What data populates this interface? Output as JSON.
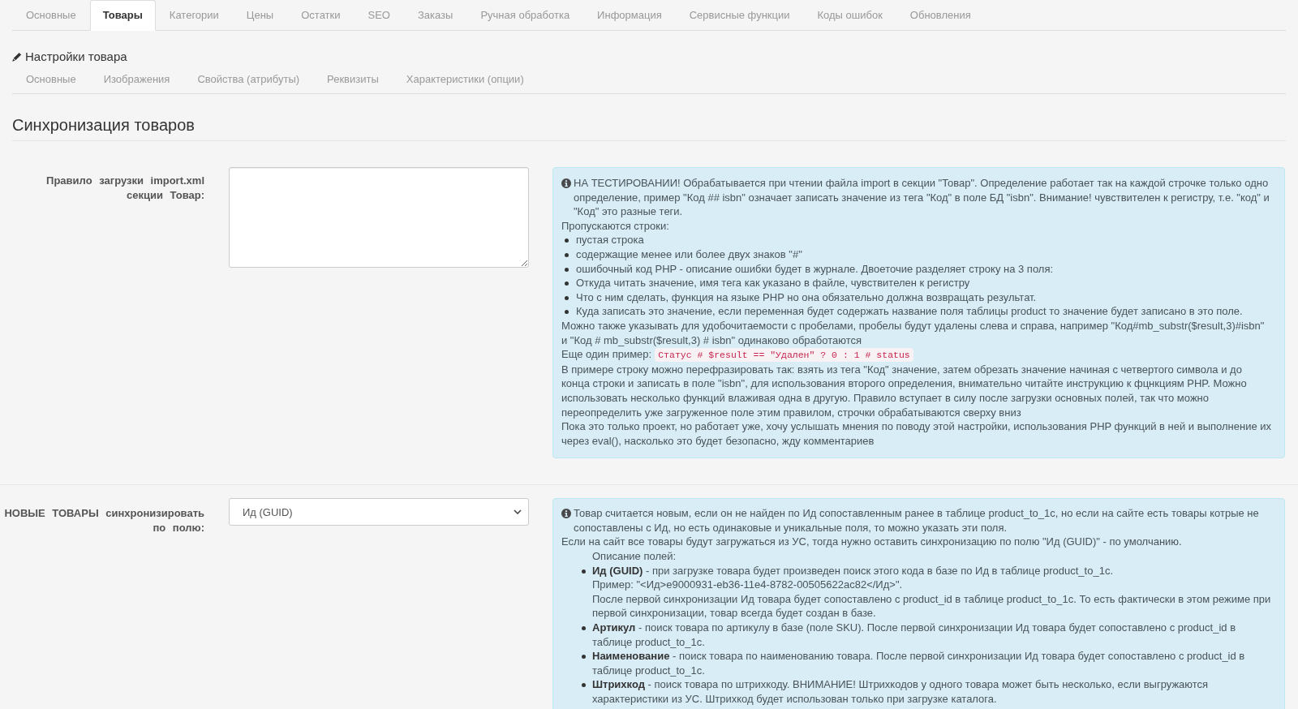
{
  "tabs": [
    {
      "label": "Основные",
      "selected": false
    },
    {
      "label": "Товары",
      "selected": true
    },
    {
      "label": "Категории",
      "selected": false
    },
    {
      "label": "Цены",
      "selected": false
    },
    {
      "label": "Остатки",
      "selected": false
    },
    {
      "label": "SEO",
      "selected": false
    },
    {
      "label": "Заказы",
      "selected": false
    },
    {
      "label": "Ручная обработка",
      "selected": false
    },
    {
      "label": "Информация",
      "selected": false
    },
    {
      "label": "Сервисные функции",
      "selected": false
    },
    {
      "label": "Коды ошибок",
      "selected": false
    },
    {
      "label": "Обновления",
      "selected": false
    }
  ],
  "product_settings": {
    "title": "Настройки товара",
    "tabs": [
      {
        "label": "Основные",
        "selected": false
      },
      {
        "label": "Изображения",
        "selected": false
      },
      {
        "label": "Свойства (атрибуты)",
        "selected": false
      },
      {
        "label": "Реквизиты",
        "selected": false
      },
      {
        "label": "Характеристики (опции)",
        "selected": false
      }
    ]
  },
  "section": {
    "title": "Синхронизация товаров",
    "fields": [
      {
        "kind": "textarea",
        "label": "Правило загрузки import.xml секции Товар:",
        "help": {
          "blocks": [
            {
              "kind": "text",
              "text": "НА ТЕСТИРОВАНИИ! Обрабатывается при чтении файла import в секции \"Товар\". Определение работает так на каждой строчке только одно определение, пример \"Код ## isbn\" означает записать значение из тега \"Код\" в поле БД \"isbn\". Внимание! чувствителен к регистру, т.е. \"код\" и \"Код\" это разные теги."
            },
            {
              "kind": "text",
              "text": "Пропускаются строки:"
            },
            {
              "kind": "list",
              "items": [
                {
                  "lines": [
                    "пустая строка"
                  ]
                },
                {
                  "lines": [
                    "содержащие менее или более двух знаков \"#\""
                  ]
                },
                {
                  "lines": [
                    "ошибочный код PHP - описание ошибки будет в журнале. Двоеточие разделяет строку на 3 поля:"
                  ]
                },
                {
                  "lines": [
                    "Откуда читать значение, имя тега как указано в файле, чувствителен к регистру"
                  ]
                },
                {
                  "lines": [
                    "Что с ним сделать, функция на языке PHP но она обязательно должна возвращать результат."
                  ]
                },
                {
                  "lines": [
                    "Куда записать это значение, если переменная будет содержать название поля таблицы product то значение будет записано в это поле."
                  ]
                }
              ]
            },
            {
              "kind": "text",
              "text": "Можно также указывать для удобочитаемости с пробелами, пробелы будут удалены слева и справа, например \"Код#mb_substr($result,3)#isbn\" и \"Код # mb_substr($result,3) # isbn\" одинаково обработаются"
            },
            {
              "kind": "example",
              "text": "Еще один пример:",
              "code": "Статус # $result == \"Удален\" ? 0 : 1 # status"
            },
            {
              "kind": "text",
              "text": "В примере строку можно перефразировать так: взять из тега \"Код\" значение, затем обрезать значение начиная с четвертого символа и до конца строки и записать в поле \"isbn\", для использования второго определения, внимательно читайте инструкцию к фцнкциям PHP. Можно использовать несколько функций влаживая одна в другую. Правило вступает в силу после загрузки основных полей, так что можно переопределить уже загруженное поле этим правилом, строчки обрабатываются сверху вниз"
            },
            {
              "kind": "text",
              "text": "Пока это только проект, но работает уже, хочу услышать мнения по поводу этой настройки, использования PHP функций в ней и выполнение их через eval(), насколько это будет безопасно, жду комментариев"
            }
          ]
        }
      },
      {
        "kind": "select",
        "label": "НОВЫЕ ТОВАРЫ синхронизировать по полю:",
        "value": "Ид (GUID)",
        "help": {
          "blocks": [
            {
              "kind": "text",
              "text": "Товар считается новым, если он не найден по Ид сопоставленным ранее в таблице product_to_1c, но если на сайте есть товары котрые не сопоставлены с Ид, но есть одинаковые и уникальные поля, то можно указать эти поля."
            },
            {
              "kind": "text",
              "text": "Если на сайт все товары будут загружаться из УС, тогда нужно оставить синхронизацию по полю \"Ид (GUID)\" - по умолчанию."
            },
            {
              "kind": "caption",
              "text": "Описание полей:"
            },
            {
              "kind": "field_list",
              "items": [
                {
                  "lines": [
                    "**Ид (GUID)** - при загрузке товара будет произведен поиск этого кода в базе по Ид в таблице product_to_1c.",
                    "Пример: \"<Ид>e9000931-eb36-11e4-8782-00505622ac82</Ид>\".",
                    "После первой синхронизации Ид товара будет сопоставлено с product_id в таблице product_to_1c. То есть фактически в этом режиме при первой синхронизации, товар всегда будет создан в базе."
                  ]
                },
                {
                  "lines": [
                    "**Артикул** - поиск товара по артикулу в базе (поле SKU). После первой синхронизации Ид товара будет сопоставлено с product_id в таблице product_to_1c."
                  ]
                },
                {
                  "lines": [
                    "**Наименование** - поиск товара по наименованию товара. После первой синхронизации Ид товара будет сопоставлено с product_id в таблице product_to_1c."
                  ]
                },
                {
                  "lines": [
                    "**Штрихкод** - поиск товара по штрихкоду. ВНИМАНИЕ! Штрихкодов у одного товара может быть несколько, если выгружаются характеристики из УС. Штрихкод будет использован только при загрузке каталога."
                  ]
                }
              ]
            }
          ]
        }
      }
    ]
  }
}
